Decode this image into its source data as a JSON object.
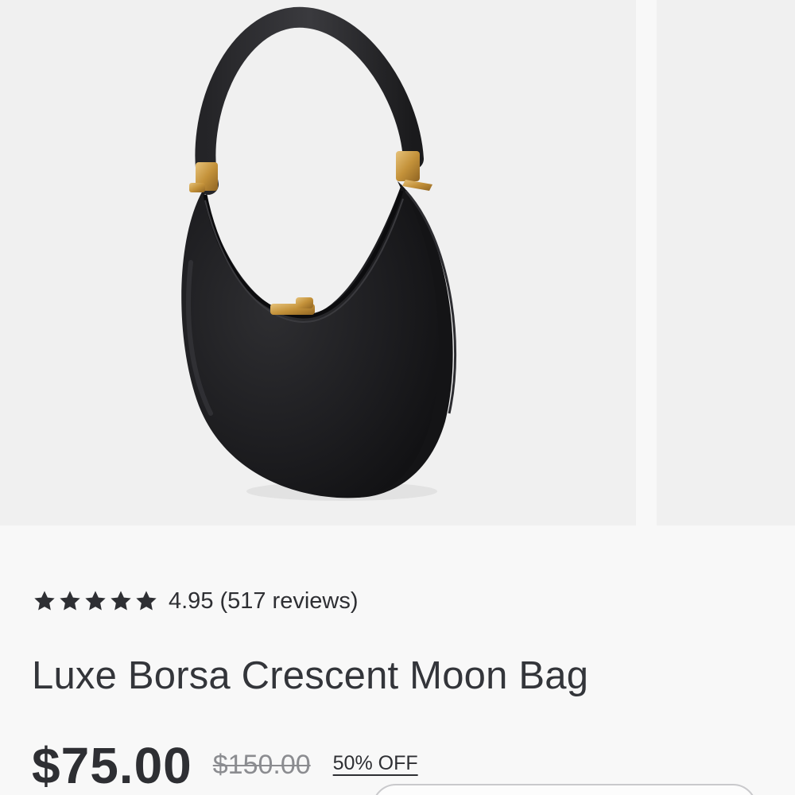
{
  "gallery": {
    "main_image_alt": "Black crescent shoulder bag",
    "next_image_alt": "Next product image"
  },
  "rating": {
    "stars": 5,
    "score": "4.95",
    "reviews": "(517 reviews)"
  },
  "product": {
    "title": "Luxe Borsa Crescent Moon Bag",
    "price": "$75.00",
    "original_price": "$150.00",
    "discount": "50% OFF"
  },
  "colors": {
    "text": "#2e2f33",
    "muted": "#8b8c90",
    "background": "#f8f8f8",
    "image_bg": "#f0f0f0",
    "bag": "#1c1c1e",
    "hardware": "#c99a3e"
  }
}
